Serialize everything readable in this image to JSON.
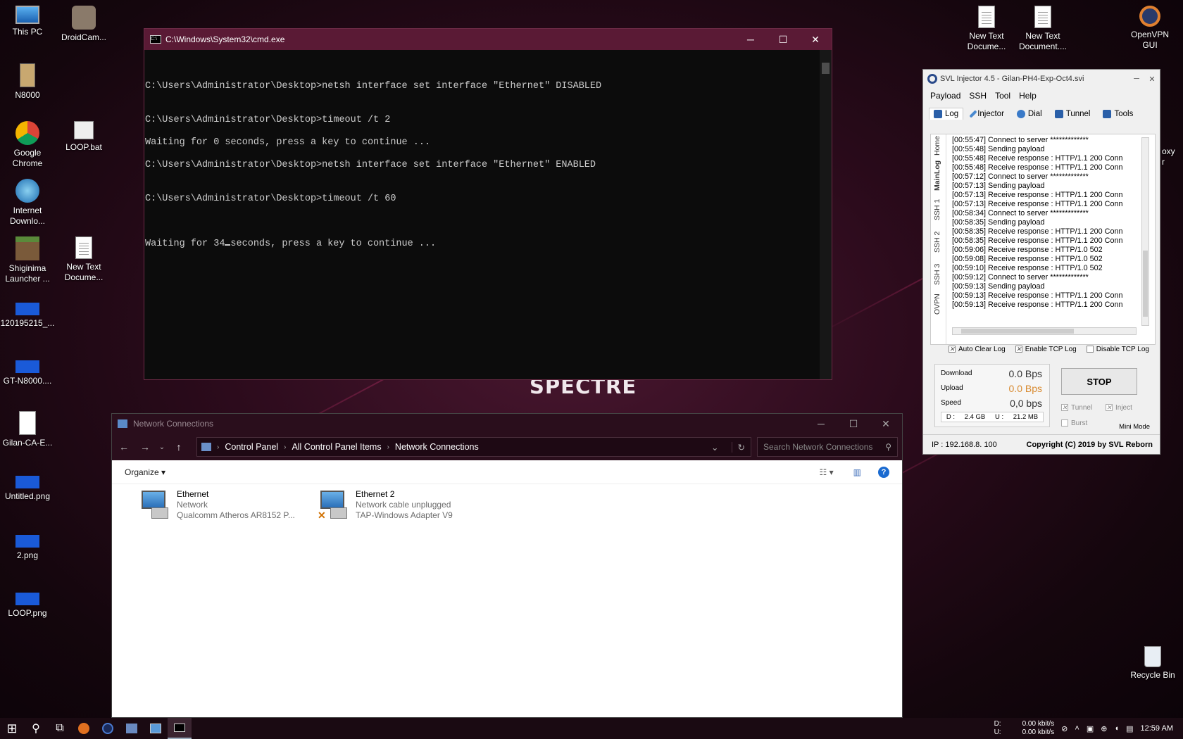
{
  "desktop": {
    "icons_left": [
      {
        "label": "This PC",
        "icon": "computer-icon"
      },
      {
        "label": "DroidCam...",
        "icon": "camera-app-icon"
      },
      {
        "label": "N8000",
        "icon": "phone-image-icon"
      },
      {
        "label": "Google Chrome",
        "icon": "chrome-icon"
      },
      {
        "label": "LOOP.bat",
        "icon": "batch-file-icon"
      },
      {
        "label": "Internet Downlo...",
        "icon": "download-manager-icon"
      },
      {
        "label": "Shiginima Launcher ...",
        "icon": "minecraft-block-icon"
      },
      {
        "label": "New Text Docume...",
        "icon": "text-document-icon"
      },
      {
        "label": "120195215_...",
        "icon": "image-file-icon"
      },
      {
        "label": "GT-N8000....",
        "icon": "image-file-icon"
      },
      {
        "label": "Gilan-CA-E...",
        "icon": "blank-document-icon"
      },
      {
        "label": "Untitled.png",
        "icon": "image-file-icon"
      },
      {
        "label": "2.png",
        "icon": "image-file-icon"
      },
      {
        "label": "LOOP.png",
        "icon": "image-file-icon"
      }
    ],
    "icons_right": [
      {
        "label": "New Text Docume...",
        "icon": "text-document-icon"
      },
      {
        "label": "New Text Document....",
        "icon": "text-document-icon"
      },
      {
        "label": "OpenVPN GUI",
        "icon": "openvpn-icon"
      }
    ],
    "recycle_bin": "Recycle Bin",
    "wallpaper_logo": "SPECTRE",
    "hidden_icon_fragment": "oxy\nr"
  },
  "cmd": {
    "title": "C:\\Windows\\System32\\cmd.exe",
    "lines": [
      "C:\\Users\\Administrator\\Desktop>netsh interface set interface \"Ethernet\" DISABLED",
      "",
      "",
      "C:\\Users\\Administrator\\Desktop>timeout /t 2",
      "",
      "Waiting for 0 seconds, press a key to continue ...",
      "",
      "C:\\Users\\Administrator\\Desktop>netsh interface set interface \"Ethernet\" ENABLED",
      "",
      "",
      "C:\\Users\\Administrator\\Desktop>timeout /t 60",
      ""
    ],
    "last_line_prefix": "Waiting for 34",
    "last_line_suffix": "seconds, press a key to continue ..."
  },
  "explorer": {
    "title": "Network Connections",
    "breadcrumb": [
      "Control Panel",
      "All Control Panel Items",
      "Network Connections"
    ],
    "search_placeholder": "Search Network Connections",
    "organize": "Organize",
    "adapters": [
      {
        "name": "Ethernet",
        "status": "Network",
        "device": "Qualcomm Atheros AR8152 P..."
      },
      {
        "name": "Ethernet 2",
        "status": "Network cable unplugged",
        "device": "TAP-Windows Adapter V9"
      }
    ]
  },
  "svl": {
    "title": "SVL Injector 4.5 - Gilan-PH4-Exp-Oct4.svi",
    "menu": [
      "Payload",
      "SSH",
      "Tool",
      "Help"
    ],
    "tabs": [
      "Log",
      "Injector",
      "Dial",
      "Tunnel",
      "Tools"
    ],
    "side_tabs": [
      "Home",
      "MainLog",
      "SSH 1",
      "SSH 2",
      "SSH 3",
      "OVPN"
    ],
    "log": [
      "[00:55:47] Connect to server *************",
      "[00:55:48] Sending payload",
      "[00:55:48] Receive response : HTTP/1.1 200 Conn",
      "[00:55:48] Receive response : HTTP/1.1 200 Conn",
      "[00:57:12] Connect to server *************",
      "[00:57:13] Sending payload",
      "[00:57:13] Receive response : HTTP/1.1 200 Conn",
      "[00:57:13] Receive response : HTTP/1.1 200 Conn",
      "[00:58:34] Connect to server *************",
      "[00:58:35] Sending payload",
      "[00:58:35] Receive response : HTTP/1.1 200 Conn",
      "[00:58:35] Receive response : HTTP/1.1 200 Conn",
      "[00:59:06] Receive response : HTTP/1.0 502",
      "[00:59:08] Receive response : HTTP/1.0 502",
      "[00:59:10] Receive response : HTTP/1.0 502",
      "[00:59:12] Connect to server *************",
      "[00:59:13] Sending payload",
      "[00:59:13] Receive response : HTTP/1.1 200 Conn",
      "[00:59:13] Receive response : HTTP/1.1 200 Conn"
    ],
    "options": {
      "auto_clear": "Auto Clear Log",
      "enable_tcp": "Enable TCP Log",
      "disable_tcp": "Disable TCP Log"
    },
    "stats": {
      "download_label": "Download",
      "download_value": "0.0 Bps",
      "upload_label": "Upload",
      "upload_value": "0.0 Bps",
      "speed_label": "Speed",
      "speed_value": "0,0 bps",
      "d_label": "D :",
      "d_value": "2.4 GB",
      "u_label": "U :",
      "u_value": "21.2 MB"
    },
    "stop": "STOP",
    "tunnel": "Tunnel",
    "inject": "Inject",
    "burst": "Burst",
    "mini_mode": "Mini Mode",
    "ip": "IP : 192.168.8. 100",
    "copyright": "Copyright (C) 2019 by SVL Reborn"
  },
  "taskbar": {
    "net_d_label": "D:",
    "net_d_value": "0.00 kbit/s",
    "net_u_label": "U:",
    "net_u_value": "0.00 kbit/s",
    "clock": "12:59 AM"
  },
  "colors": {
    "cmd_title": "#5a1a35",
    "accent_orange": "#d88a30"
  }
}
